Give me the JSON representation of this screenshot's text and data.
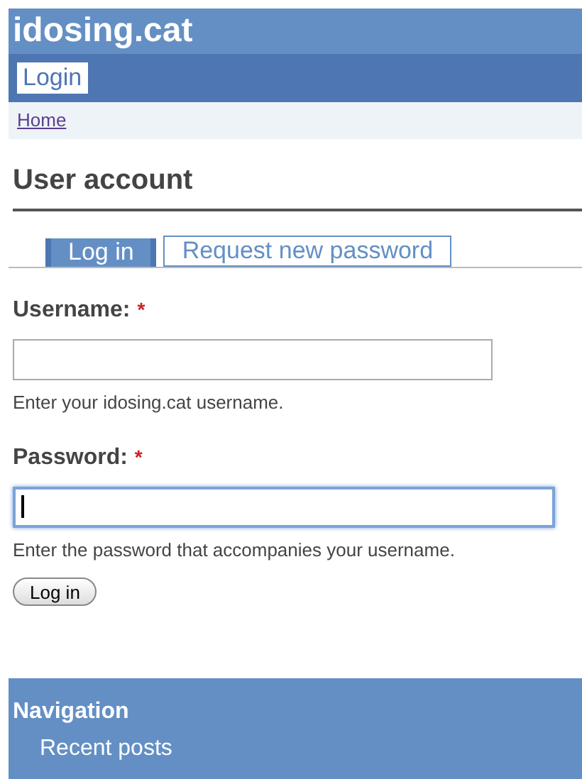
{
  "site_name": "idosing.cat",
  "primary_links": [
    {
      "label": "Login",
      "selected": true
    }
  ],
  "breadcrumb": [
    "Home"
  ],
  "page_title": "User account",
  "tabs": [
    {
      "label": "Log in",
      "selected": true
    },
    {
      "label": "Request new password",
      "selected": false
    }
  ],
  "fields": [
    {
      "label": "Username:",
      "required_mark": "*",
      "focused": false,
      "description": "Enter your idosing.cat username."
    },
    {
      "label": "Password:",
      "required_mark": "*",
      "focused": true,
      "description": "Enter the password that accompanies your username."
    }
  ],
  "submit_button": "Log in",
  "navigation": {
    "title": "Navigation",
    "items": [
      "Recent posts"
    ]
  }
}
